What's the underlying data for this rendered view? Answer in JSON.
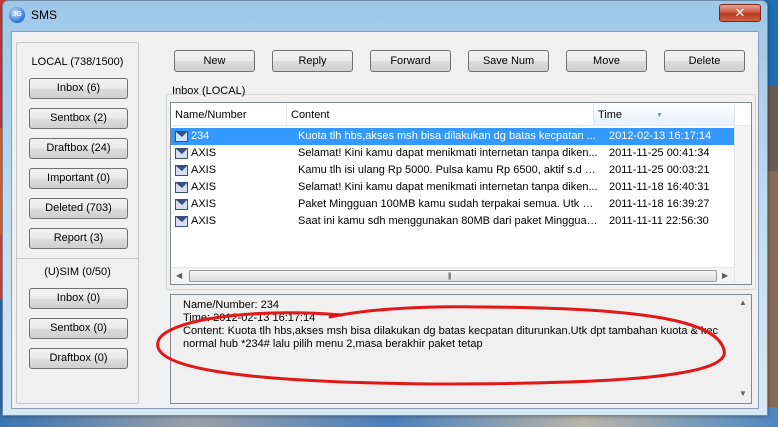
{
  "window": {
    "title": "SMS",
    "icon": "app-icon",
    "close_label": "✕"
  },
  "local": {
    "title": "LOCAL (738/1500)",
    "buttons": [
      "Inbox (6)",
      "Sentbox (2)",
      "Draftbox (24)",
      "Important (0)",
      "Deleted (703)",
      "Report (3)"
    ]
  },
  "sim": {
    "title": "(U)SIM (0/50)",
    "buttons": [
      "Inbox (0)",
      "Sentbox (0)",
      "Draftbox (0)"
    ]
  },
  "toolbar": [
    "New",
    "Reply",
    "Forward",
    "Save Num",
    "Move",
    "Delete"
  ],
  "inbox": {
    "label": "Inbox (LOCAL)",
    "columns": [
      "Name/Number",
      "Content",
      "Time"
    ],
    "sort_column": "Time",
    "rows": [
      {
        "name": "234",
        "content": "Kuota tlh hbs,akses msh bisa dilakukan dg batas kecpatan ...",
        "time": "2012-02-13 16:17:14",
        "selected": true
      },
      {
        "name": "AXIS",
        "content": "Selamat! Kini kamu dapat menikmati internetan tanpa diken...",
        "time": "2011-11-25 00:41:34",
        "selected": false
      },
      {
        "name": "AXIS",
        "content": "Kamu tlh isi ulang Rp 5000. Pulsa kamu Rp 6500, aktif s.d 2...",
        "time": "2011-11-25 00:03:21",
        "selected": false
      },
      {
        "name": "AXIS",
        "content": "Selamat! Kini kamu dapat menikmati internetan tanpa diken...",
        "time": "2011-11-18 16:40:31",
        "selected": false
      },
      {
        "name": "AXIS",
        "content": "Paket Mingguan 100MB kamu sudah terpakai semua. Utk m...",
        "time": "2011-11-18 16:39:27",
        "selected": false
      },
      {
        "name": "AXIS",
        "content": "Saat ini kamu sdh menggunakan 80MB dari paket Mingguan ...",
        "time": "2011-11-11 22:56:30",
        "selected": false
      }
    ]
  },
  "detail": {
    "line1": "Name/Number: 234",
    "line2": "Time: 2012-02-13 16:17:14",
    "line3": "Content:    Kuota tlh hbs,akses msh bisa dilakukan dg batas kecpatan diturunkan.Utk dpt tambahan kuota & kec",
    "line4": "normal hub *234# lalu pilih menu 2,masa berakhir paket tetap"
  },
  "colors": {
    "selection": "#3399ff",
    "annotation": "#e01818"
  }
}
